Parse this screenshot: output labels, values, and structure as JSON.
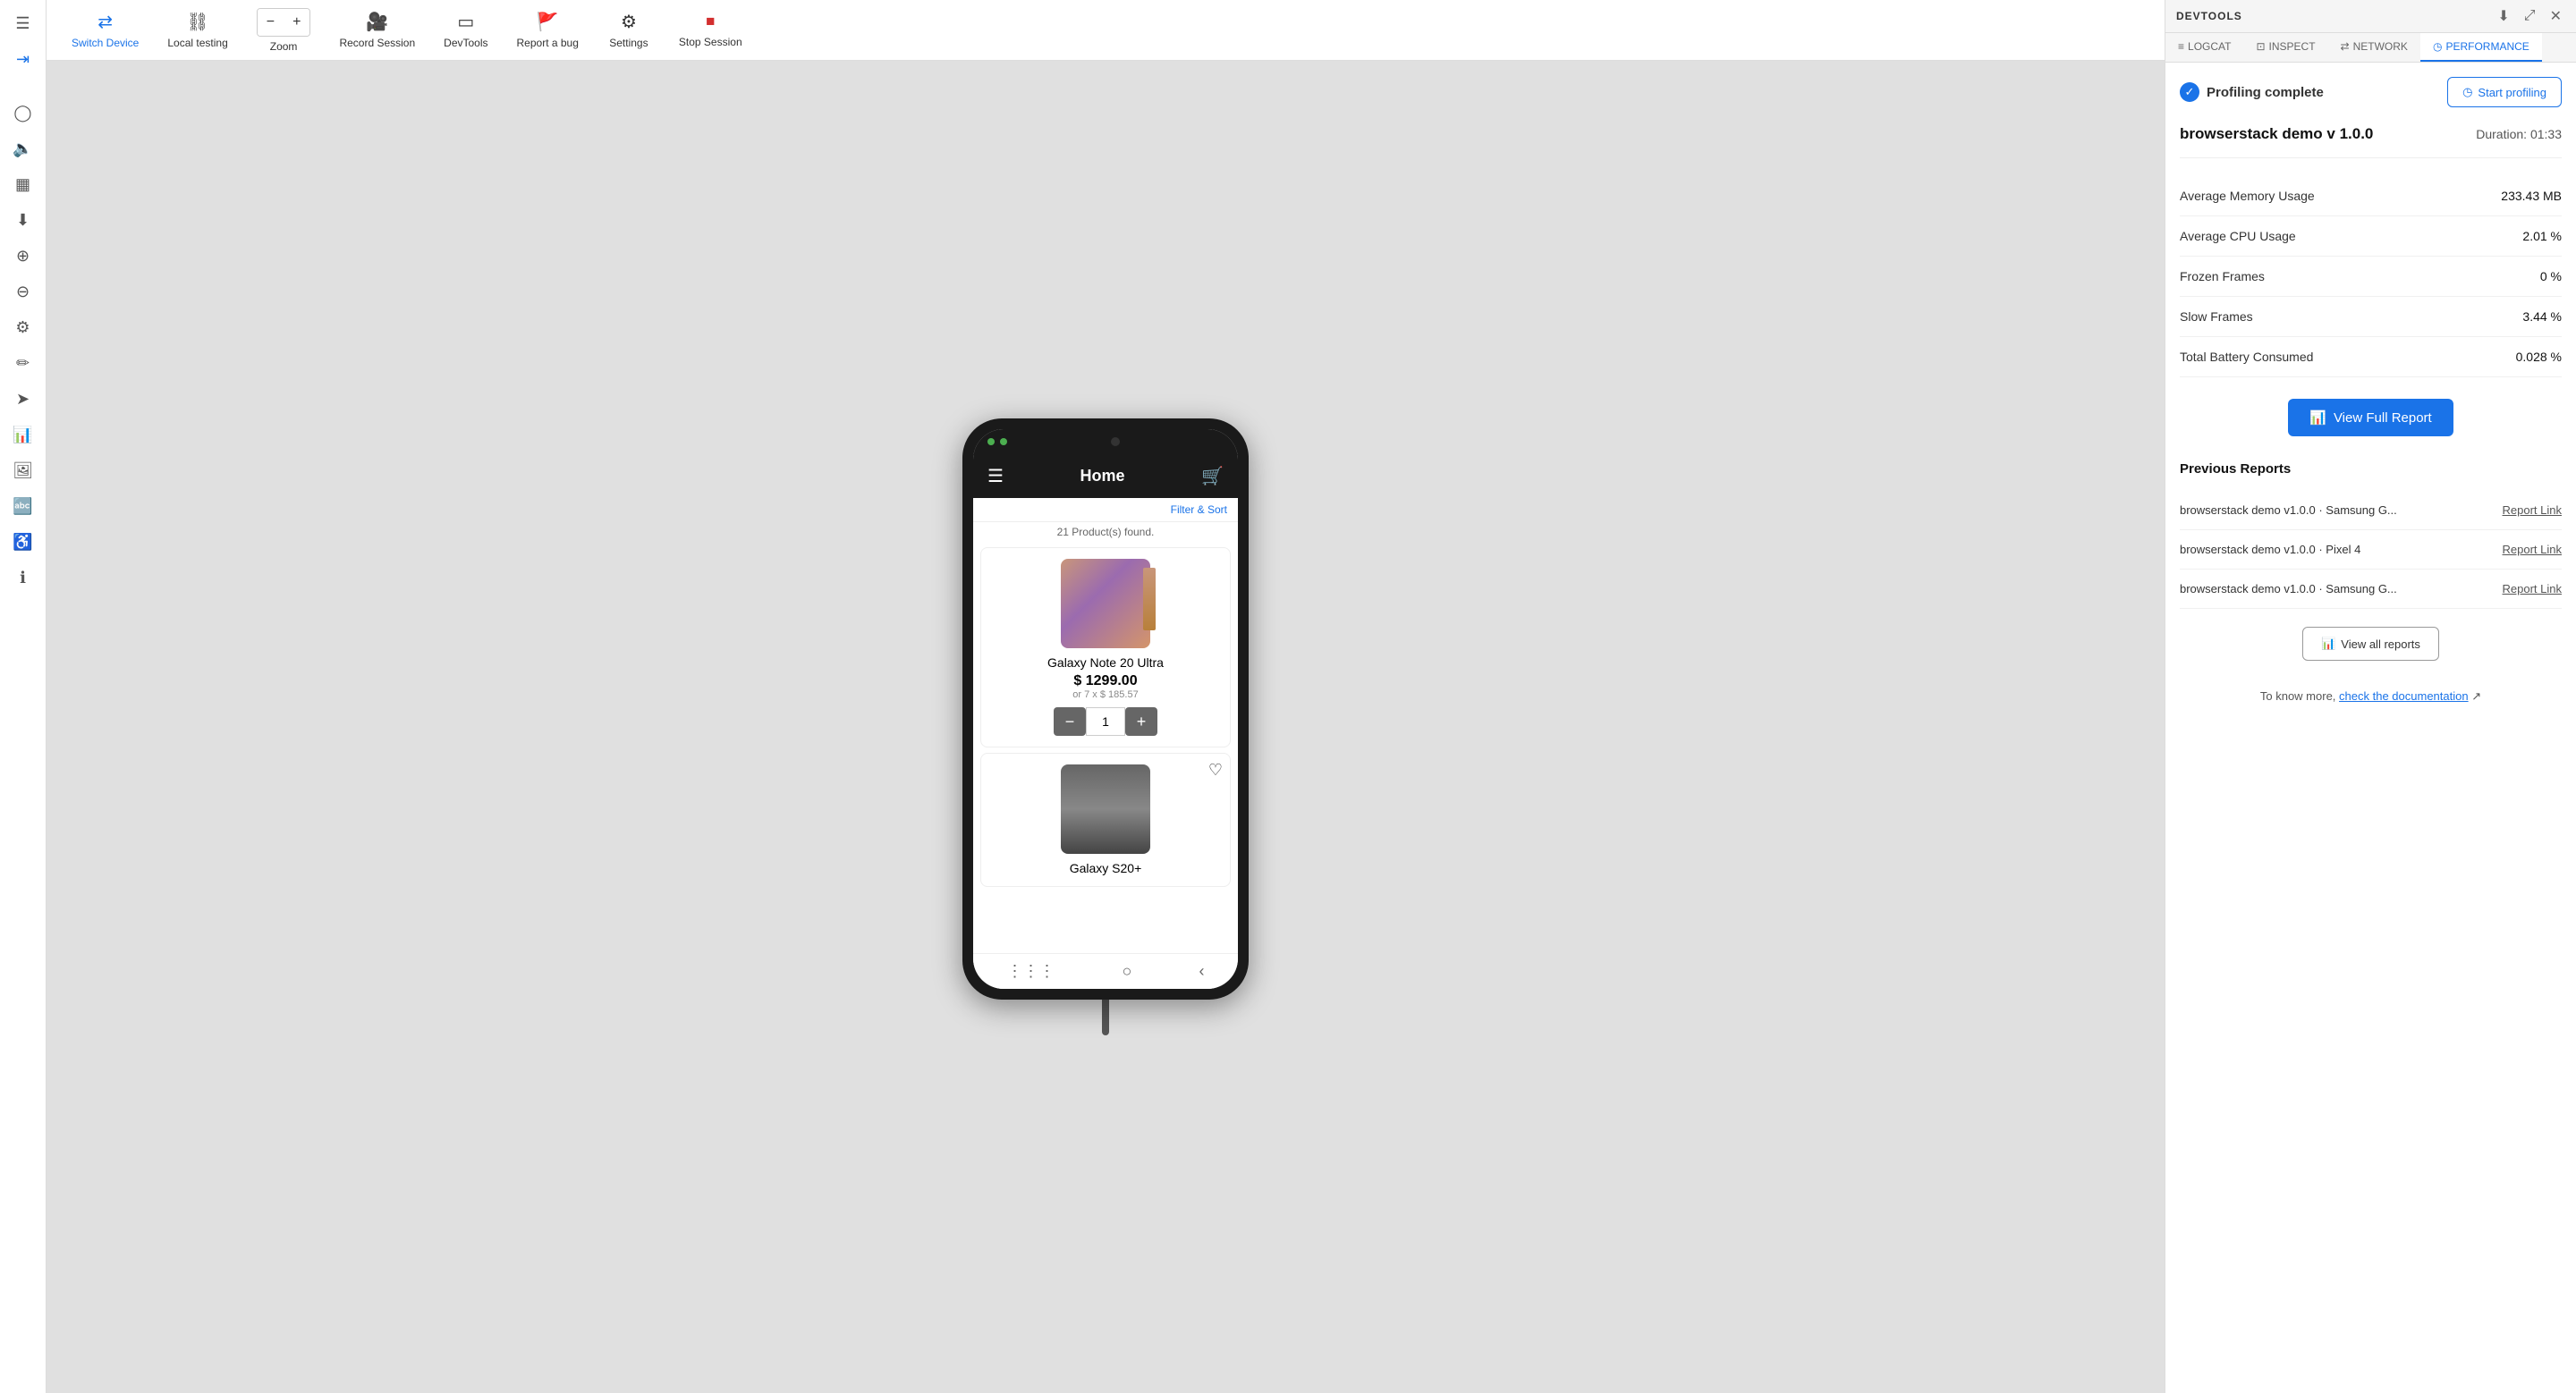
{
  "sidebar": {
    "items": [
      {
        "name": "menu-icon",
        "symbol": "☰",
        "active": false
      },
      {
        "name": "forward-icon",
        "symbol": "→",
        "active": false
      },
      {
        "name": "circle-icon",
        "symbol": "●",
        "active": false
      },
      {
        "name": "speaker-icon",
        "symbol": "🔈",
        "active": false
      },
      {
        "name": "panels-icon",
        "symbol": "▦",
        "active": false
      },
      {
        "name": "download-icon",
        "symbol": "⬇",
        "active": false
      },
      {
        "name": "crosshair-icon",
        "symbol": "⊕",
        "active": false
      },
      {
        "name": "minus-circle-icon",
        "symbol": "⊖",
        "active": false
      },
      {
        "name": "settings-icon",
        "symbol": "⚙",
        "active": false
      },
      {
        "name": "brush-icon",
        "symbol": "✏",
        "active": false
      },
      {
        "name": "send-icon",
        "symbol": "➤",
        "active": false
      },
      {
        "name": "chart-icon",
        "symbol": "📊",
        "active": false
      },
      {
        "name": "gallery-icon",
        "symbol": "🖼",
        "active": false
      },
      {
        "name": "translate-icon",
        "symbol": "🔤",
        "active": false
      },
      {
        "name": "accessibility-icon",
        "symbol": "♿",
        "active": false
      },
      {
        "name": "info-icon",
        "symbol": "ℹ",
        "active": false
      }
    ]
  },
  "toolbar": {
    "switch_device_label": "Switch Device",
    "local_testing_label": "Local testing",
    "zoom_label": "Zoom",
    "record_session_label": "Record Session",
    "devtools_label": "DevTools",
    "report_bug_label": "Report a bug",
    "settings_label": "Settings",
    "stop_session_label": "Stop Session"
  },
  "phone": {
    "app_title": "Home",
    "products_found": "21 Product(s) found.",
    "filter_sort": "Filter & Sort",
    "products": [
      {
        "name": "Galaxy Note 20 Ultra",
        "price": "$ 1299.00",
        "price_alt": "or 7 x $ 185.57",
        "qty": "1"
      },
      {
        "name": "Galaxy S20+",
        "price": "",
        "price_alt": "",
        "qty": ""
      }
    ]
  },
  "devtools": {
    "title": "DEVTOOLS",
    "tabs": [
      {
        "name": "logcat",
        "label": "LOGCAT",
        "active": false
      },
      {
        "name": "inspect",
        "label": "INSPECT",
        "active": false
      },
      {
        "name": "network",
        "label": "NETWORK",
        "active": false
      },
      {
        "name": "performance",
        "label": "PERFORMANCE",
        "active": true
      }
    ],
    "profiling_complete_label": "Profiling complete",
    "start_profiling_label": "Start profiling",
    "app_name": "browserstack demo v 1.0.0",
    "duration_label": "Duration:",
    "duration_value": "01:33",
    "metrics": [
      {
        "label": "Average Memory Usage",
        "value": "233.43 MB"
      },
      {
        "label": "Average CPU Usage",
        "value": "2.01 %"
      },
      {
        "label": "Frozen Frames",
        "value": "0 %"
      },
      {
        "label": "Slow Frames",
        "value": "3.44 %"
      },
      {
        "label": "Total Battery Consumed",
        "value": "0.028 %"
      }
    ],
    "view_full_report_label": "View Full Report",
    "previous_reports_title": "Previous Reports",
    "previous_reports": [
      {
        "name": "browserstack demo v1.0.0 · Samsung G...",
        "link": "Report Link"
      },
      {
        "name": "browserstack demo v1.0.0 · Pixel 4",
        "link": "Report Link"
      },
      {
        "name": "browserstack demo v1.0.0 · Samsung G...",
        "link": "Report Link"
      }
    ],
    "view_all_reports_label": "View all reports",
    "docs_text": "To know more,",
    "docs_link_text": "check the documentation"
  }
}
